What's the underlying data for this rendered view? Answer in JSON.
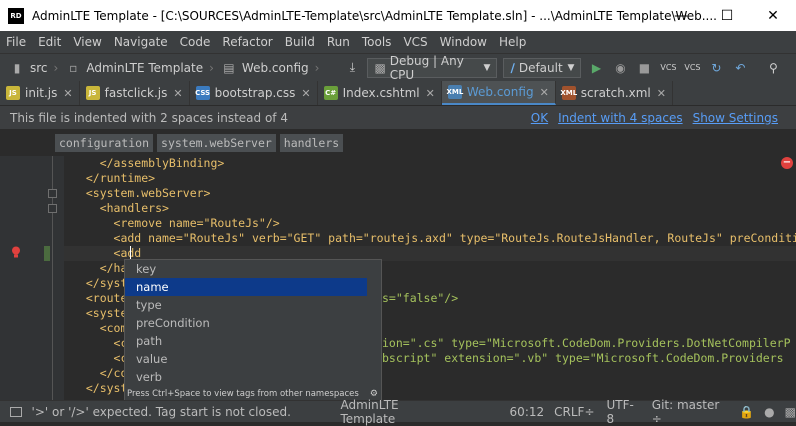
{
  "window": {
    "title": "AdminLTE Template - [C:\\SOURCES\\AdminLTE-Template\\src\\AdminLTE Template.sln] - ...\\AdminLTE Template\\Web....",
    "app_icon_text": "RD"
  },
  "menu": [
    "File",
    "Edit",
    "View",
    "Navigate",
    "Code",
    "Refactor",
    "Build",
    "Run",
    "Tools",
    "VCS",
    "Window",
    "Help"
  ],
  "toolbar": {
    "crumbs": [
      "src",
      "AdminLTE Template",
      "Web.config"
    ],
    "config_combo": "Debug | Any CPU",
    "run_combo": "Default"
  },
  "tabs": [
    {
      "label": "init.js",
      "icon": "JS",
      "color": "#c9b63a"
    },
    {
      "label": "fastclick.js",
      "icon": "JS",
      "color": "#c9b63a"
    },
    {
      "label": "bootstrap.css",
      "icon": "CSS",
      "color": "#3b7bbf"
    },
    {
      "label": "Index.cshtml",
      "icon": "C#",
      "color": "#6a9f3a"
    },
    {
      "label": "Web.config",
      "icon": "XML",
      "color": "#4a7fb0"
    },
    {
      "label": "scratch.xml",
      "icon": "XML",
      "color": "#a0522d"
    }
  ],
  "notice": {
    "message": "This file is indented with 2 spaces instead of 4",
    "links": [
      "OK",
      "Indent with 4 spaces",
      "Show Settings"
    ]
  },
  "breadcrumbs": [
    "configuration",
    "system.webServer",
    "handlers"
  ],
  "code_lines": [
    "    </assemblyBinding>",
    "  </runtime>",
    "  <system.webServer>",
    "    <handlers>",
    "      <remove name=\"RouteJs\"/>",
    "      <add name=\"RouteJs\" verb=\"GET\" path=\"routejs.axd\" type=\"RouteJs.RouteJsHandler, RouteJs\" preConditio",
    "      <add ",
    "    </hand",
    "  </system",
    "  <routeJs",
    "  <system.",
    "    <compi",
    "      <com",
    "      <com",
    "    </com",
    "  </syste"
  ],
  "code_right": {
    "line9": "s=\"false\"/>",
    "line12": "ion=\".cs\" type=\"Microsoft.CodeDom.Providers.DotNetCompilerP",
    "line13": "bscript\" extension=\".vb\" type=\"Microsoft.CodeDom.Providers"
  },
  "completion": {
    "items": [
      "key",
      "name",
      "type",
      "preCondition",
      "path",
      "value",
      "verb"
    ],
    "selected": "name",
    "hint": "Press Ctrl+Space to view tags from other namespaces"
  },
  "status": {
    "message": "'>' or '/>' expected. Tag start is not closed.",
    "project": "AdminLTE Template",
    "position": "60:12",
    "line_ending": "CRLF÷",
    "encoding": "UTF-8",
    "vcs": "Git: master ÷"
  },
  "colors": {
    "tag": "#e8bf6a",
    "attr": "#bababa",
    "value": "#a5c25c",
    "link": "#589df6",
    "selection": "#0d3a8a"
  }
}
